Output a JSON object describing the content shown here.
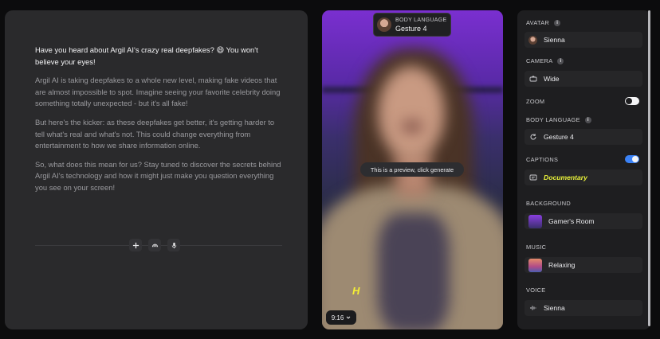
{
  "script": {
    "paragraphs": [
      "Have you heard about Argil AI's crazy real deepfakes? 😄 You won't believe your eyes!",
      "Argil AI is taking deepfakes to a whole new level, making fake videos that are almost impossible to spot. Imagine seeing your favorite celebrity doing something totally unexpected - but it's all fake!",
      "But here's the kicker: as these deepfakes get better, it's getting harder to tell what's real and what's not. This could change everything from entertainment to how we share information online.",
      "So, what does this mean for us? Stay tuned to discover the secrets behind Argil AI's technology and how it might just make you question everything you see on your screen!"
    ],
    "tools": [
      "plus-icon",
      "wave-icon",
      "microphone-icon"
    ]
  },
  "preview": {
    "badge_label": "BODY LANGUAGE",
    "badge_value": "Gesture 4",
    "preview_message": "This is a preview, click generate",
    "caption_sample": "H",
    "aspect_ratio": "9:16"
  },
  "settings": {
    "avatar": {
      "label": "AVATAR",
      "value": "Sienna"
    },
    "camera": {
      "label": "CAMERA",
      "value": "Wide"
    },
    "zoom": {
      "label": "ZOOM",
      "enabled": false
    },
    "body_language": {
      "label": "BODY LANGUAGE",
      "value": "Gesture 4"
    },
    "captions": {
      "label": "CAPTIONS",
      "enabled": true,
      "value": "Documentary"
    },
    "background": {
      "label": "BACKGROUND",
      "value": "Gamer's Room"
    },
    "music": {
      "label": "MUSIC",
      "value": "Relaxing"
    },
    "voice": {
      "label": "VOICE",
      "value": "Sienna"
    }
  },
  "colors": {
    "accent_toggle": "#3b82f6",
    "caption_highlight": "#e9f23a",
    "panel_bg": "#2a2a2c"
  }
}
